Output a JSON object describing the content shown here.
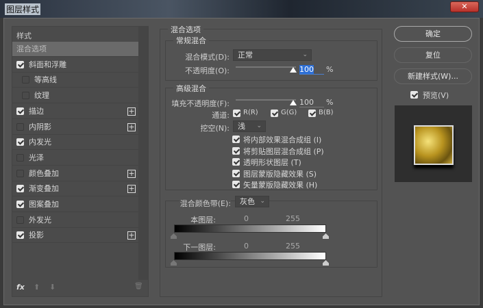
{
  "window": {
    "title": "图层样式",
    "close": "✕"
  },
  "styles_panel": {
    "header": "样式",
    "items": [
      {
        "label": "混合选项",
        "selected": true
      },
      {
        "label": "斜面和浮雕",
        "checked": true
      },
      {
        "label": "等高线",
        "checked": false,
        "indent": true
      },
      {
        "label": "纹理",
        "checked": false,
        "indent": true
      },
      {
        "label": "描边",
        "checked": true,
        "plus": true
      },
      {
        "label": "内阴影",
        "checked": false,
        "plus": true
      },
      {
        "label": "内发光",
        "checked": true
      },
      {
        "label": "光泽",
        "checked": false
      },
      {
        "label": "颜色叠加",
        "checked": false,
        "plus": true
      },
      {
        "label": "渐变叠加",
        "checked": true,
        "plus": true
      },
      {
        "label": "图案叠加",
        "checked": true
      },
      {
        "label": "外发光",
        "checked": false
      },
      {
        "label": "投影",
        "checked": true,
        "plus": true
      }
    ],
    "footer": {
      "fx": "fx",
      "up": "⬆",
      "down": "⬇",
      "trash": "🗑"
    }
  },
  "blending": {
    "title": "混合选项",
    "general": {
      "title": "常规混合",
      "mode_label": "混合模式(D):",
      "mode_value": "正常",
      "opacity_label": "不透明度(O):",
      "opacity_value": "100",
      "opacity_unit": "%",
      "opacity_percent": 100
    },
    "advanced": {
      "title": "高级混合",
      "fill_label": "填充不透明度(F):",
      "fill_value": "100",
      "fill_unit": "%",
      "fill_percent": 100,
      "channels_label": "通道:",
      "channels": [
        {
          "label": "R(R)",
          "checked": true
        },
        {
          "label": "G(G)",
          "checked": true
        },
        {
          "label": "B(B)",
          "checked": true
        }
      ],
      "knockout_label": "挖空(N):",
      "knockout_value": "浅",
      "options": [
        {
          "label": "将内部效果混合成组 (I)",
          "checked": true
        },
        {
          "label": "将剪贴图层混合成组 (P)",
          "checked": true
        },
        {
          "label": "透明形状图层 (T)",
          "checked": true
        },
        {
          "label": "图层蒙版隐藏效果 (S)",
          "checked": true
        },
        {
          "label": "矢量蒙版隐藏效果 (H)",
          "checked": true
        }
      ]
    },
    "blend_if": {
      "label": "混合颜色带(E):",
      "value": "灰色",
      "this_layer": "本图层:",
      "underlying": "下一图层:",
      "min": "0",
      "max": "255"
    }
  },
  "buttons": {
    "ok": "确定",
    "reset": "复位",
    "new_style": "新建样式(W)...",
    "preview": "预览(V)",
    "preview_checked": true
  }
}
